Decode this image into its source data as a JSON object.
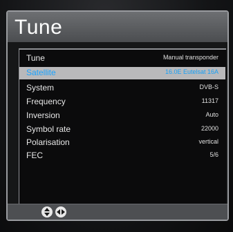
{
  "screen": {
    "title": "Tune"
  },
  "menu": {
    "rows": [
      {
        "label": "Tune",
        "value": "Manual transponder",
        "selected": false
      },
      {
        "label": "Satellite",
        "value": "16.0E Eutelsat 16A",
        "selected": true
      },
      {
        "label": "System",
        "value": "DVB-S",
        "selected": false
      },
      {
        "label": "Frequency",
        "value": "11317",
        "selected": false
      },
      {
        "label": "Inversion",
        "value": "Auto",
        "selected": false
      },
      {
        "label": "Symbol rate",
        "value": "22000",
        "selected": false
      },
      {
        "label": "Polarisation",
        "value": "vertical",
        "selected": false
      },
      {
        "label": "FEC",
        "value": "5/6",
        "selected": false
      }
    ]
  },
  "footer": {
    "buttons": [
      {
        "name": "up-down",
        "icon": "up-down-arrows-icon"
      },
      {
        "name": "left-right",
        "icon": "left-right-arrows-icon"
      }
    ]
  },
  "colors": {
    "highlight_bg": "#b9b9bb",
    "highlight_text": "#1aa3ff",
    "header": "#5d5f62"
  }
}
